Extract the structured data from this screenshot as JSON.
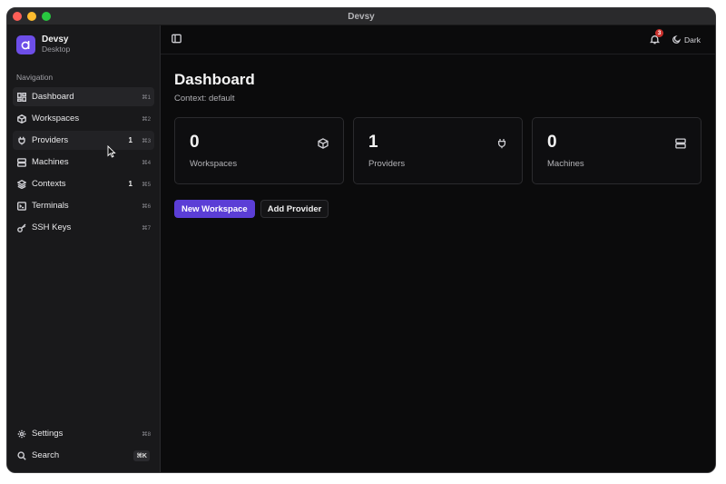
{
  "window": {
    "title": "Devsy"
  },
  "brand": {
    "name": "Devsy",
    "subtitle": "Desktop"
  },
  "sidebar": {
    "heading": "Navigation",
    "items": [
      {
        "label": "Dashboard",
        "icon": "dashboard-icon",
        "shortcut": "⌘1",
        "badge": ""
      },
      {
        "label": "Workspaces",
        "icon": "cube-icon",
        "shortcut": "⌘2",
        "badge": ""
      },
      {
        "label": "Providers",
        "icon": "plug-icon",
        "shortcut": "⌘3",
        "badge": "1"
      },
      {
        "label": "Machines",
        "icon": "server-icon",
        "shortcut": "⌘4",
        "badge": ""
      },
      {
        "label": "Contexts",
        "icon": "layers-icon",
        "shortcut": "⌘5",
        "badge": "1"
      },
      {
        "label": "Terminals",
        "icon": "terminal-icon",
        "shortcut": "⌘6",
        "badge": ""
      },
      {
        "label": "SSH Keys",
        "icon": "key-icon",
        "shortcut": "⌘7",
        "badge": ""
      }
    ],
    "bottom": [
      {
        "label": "Settings",
        "icon": "gear-icon",
        "shortcut": "⌘8"
      },
      {
        "label": "Search",
        "icon": "search-icon",
        "shortcut": "⌘K"
      }
    ]
  },
  "topbar": {
    "notification_count": "3",
    "theme_label": "Dark"
  },
  "main": {
    "title": "Dashboard",
    "context": "Context: default",
    "stats": [
      {
        "value": "0",
        "label": "Workspaces",
        "icon": "cube-icon"
      },
      {
        "value": "1",
        "label": "Providers",
        "icon": "plug-icon"
      },
      {
        "value": "0",
        "label": "Machines",
        "icon": "server-icon"
      }
    ],
    "actions": {
      "primary": "New Workspace",
      "secondary": "Add Provider"
    }
  },
  "colors": {
    "accent": "#5b3ed6",
    "brand": "#6d4ee8",
    "badge": "#c9302c"
  }
}
